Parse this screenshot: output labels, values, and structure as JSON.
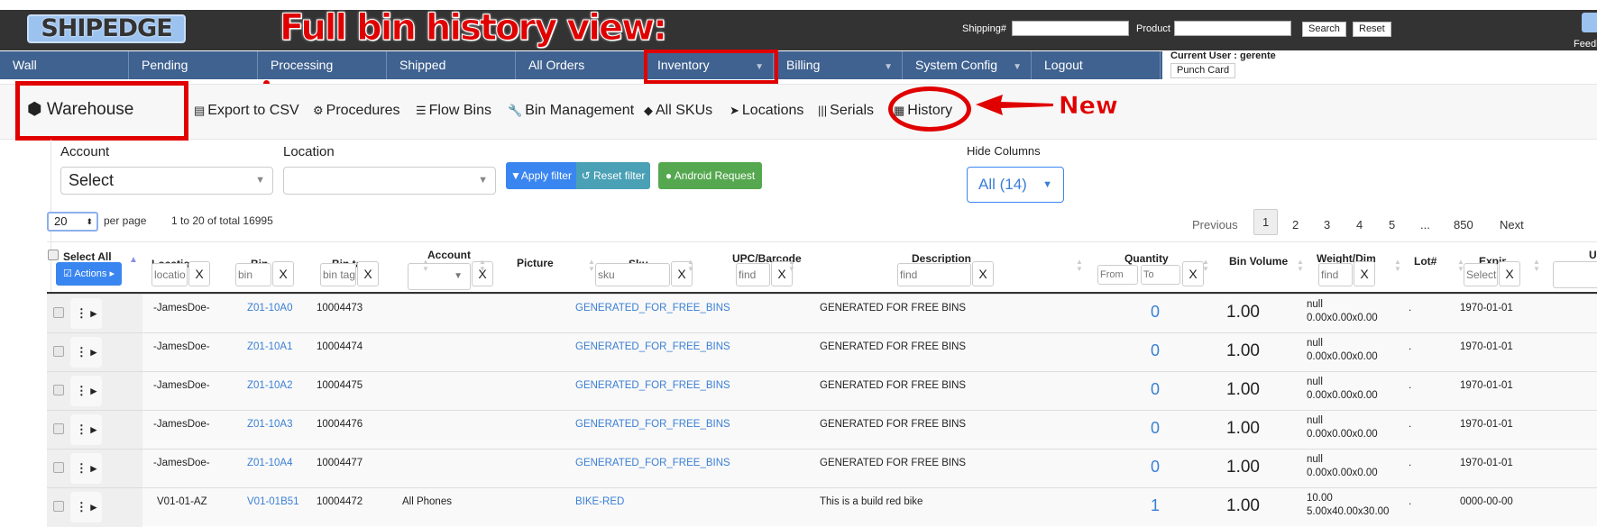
{
  "annotation": {
    "title": "Full bin history view:",
    "new_label": "New"
  },
  "header": {
    "logo": "SHIPEDGE",
    "shipping_label": "Shipping#",
    "shipping_value": "",
    "product_label": "Product",
    "product_value": "",
    "search": "Search",
    "reset": "Reset",
    "feedback": "Feedb"
  },
  "nav": [
    {
      "label": "Wall"
    },
    {
      "label": "Pending"
    },
    {
      "label": "Processing"
    },
    {
      "label": "Shipped"
    },
    {
      "label": "All Orders"
    },
    {
      "label": "Inventory",
      "dropdown": true
    },
    {
      "label": "Billing",
      "dropdown": true
    },
    {
      "label": "System Config",
      "dropdown": true
    },
    {
      "label": "Logout"
    }
  ],
  "user": {
    "current": "Current User : gerente",
    "punch": "Punch Card"
  },
  "toolbar": {
    "warehouse": "Warehouse",
    "items": [
      {
        "label": "Export to CSV",
        "icon": "file-excel-icon"
      },
      {
        "label": "Procedures",
        "icon": "gear-icon"
      },
      {
        "label": "Flow Bins",
        "icon": "list-icon"
      },
      {
        "label": "Bin Management",
        "icon": "wrench-icon"
      },
      {
        "label": "All SKUs",
        "icon": "tags-icon"
      },
      {
        "label": "Locations",
        "icon": "location-arrow-icon"
      },
      {
        "label": "Serials",
        "icon": "barcode-icon"
      },
      {
        "label": "History",
        "icon": "calendar-icon"
      }
    ]
  },
  "filters": {
    "account_label": "Account",
    "account_value": "Select",
    "location_label": "Location",
    "location_value": "",
    "apply": "Apply filter",
    "reset": "Reset filter",
    "android": "Android Request",
    "hide_label": "Hide Columns",
    "hide_value": "All (14)"
  },
  "paging": {
    "per_page_value": "20",
    "per_page_label": "per page",
    "summary": "1 to 20 of total 16995",
    "previous": "Previous",
    "pages": [
      "1",
      "2",
      "3",
      "4",
      "5",
      "...",
      "850"
    ],
    "current": "1",
    "next": "Next"
  },
  "table": {
    "select_all": "Select All",
    "actions": "Actions",
    "columns": {
      "location": "Location",
      "bin": "Bin",
      "bin_tag": "Bin tag",
      "account": "Account",
      "picture": "Picture",
      "sku": "Sku",
      "upc": "UPC/Barcode",
      "description": "Description",
      "quantity": "Quantity",
      "bin_volume": "Bin Volume",
      "weight": "Weight/Dim",
      "lot": "Lot#",
      "expir": "Expir",
      "u": "U"
    },
    "filter_placeholders": {
      "location": "locatio",
      "bin": "bin",
      "bin_tag": "bin tag",
      "sku": "sku",
      "upc": "find",
      "description": "find",
      "qty_from": "From",
      "qty_to": "To",
      "weight": "find",
      "expir": "Select",
      "clear": "X"
    },
    "rows": [
      {
        "location": "-JamesDoe-",
        "bin": "Z01-10A0",
        "bin_tag": "10004473",
        "account": "",
        "sku": "GENERATED_FOR_FREE_BINS",
        "description": "GENERATED FOR FREE BINS",
        "quantity": "0",
        "bin_volume": "1.00",
        "weight": "null",
        "dim": "0.00x0.00x0.00",
        "lot": ".",
        "expir": "1970-01-01"
      },
      {
        "location": "-JamesDoe-",
        "bin": "Z01-10A1",
        "bin_tag": "10004474",
        "account": "",
        "sku": "GENERATED_FOR_FREE_BINS",
        "description": "GENERATED FOR FREE BINS",
        "quantity": "0",
        "bin_volume": "1.00",
        "weight": "null",
        "dim": "0.00x0.00x0.00",
        "lot": ".",
        "expir": "1970-01-01"
      },
      {
        "location": "-JamesDoe-",
        "bin": "Z01-10A2",
        "bin_tag": "10004475",
        "account": "",
        "sku": "GENERATED_FOR_FREE_BINS",
        "description": "GENERATED FOR FREE BINS",
        "quantity": "0",
        "bin_volume": "1.00",
        "weight": "null",
        "dim": "0.00x0.00x0.00",
        "lot": ".",
        "expir": "1970-01-01"
      },
      {
        "location": "-JamesDoe-",
        "bin": "Z01-10A3",
        "bin_tag": "10004476",
        "account": "",
        "sku": "GENERATED_FOR_FREE_BINS",
        "description": "GENERATED FOR FREE BINS",
        "quantity": "0",
        "bin_volume": "1.00",
        "weight": "null",
        "dim": "0.00x0.00x0.00",
        "lot": ".",
        "expir": "1970-01-01"
      },
      {
        "location": "-JamesDoe-",
        "bin": "Z01-10A4",
        "bin_tag": "10004477",
        "account": "",
        "sku": "GENERATED_FOR_FREE_BINS",
        "description": "GENERATED FOR FREE BINS",
        "quantity": "0",
        "bin_volume": "1.00",
        "weight": "null",
        "dim": "0.00x0.00x0.00",
        "lot": ".",
        "expir": "1970-01-01"
      },
      {
        "location": "V01-01-AZ",
        "bin": "V01-01B51",
        "bin_tag": "10004472",
        "account": "All Phones",
        "sku": "BIKE-RED",
        "description": "This is a build red bike",
        "quantity": "1",
        "bin_volume": "1.00",
        "weight": "10.00",
        "dim": "5.00x40.00x30.00",
        "lot": ".",
        "expir": "0000-00-00"
      }
    ]
  },
  "colors": {
    "nav": "#3f6290",
    "header": "#333333",
    "accent": "#3a7fd5",
    "annotation": "#e00000",
    "apply": "#3a86f0",
    "reset": "#4aa0b5",
    "android": "#55a84f"
  }
}
